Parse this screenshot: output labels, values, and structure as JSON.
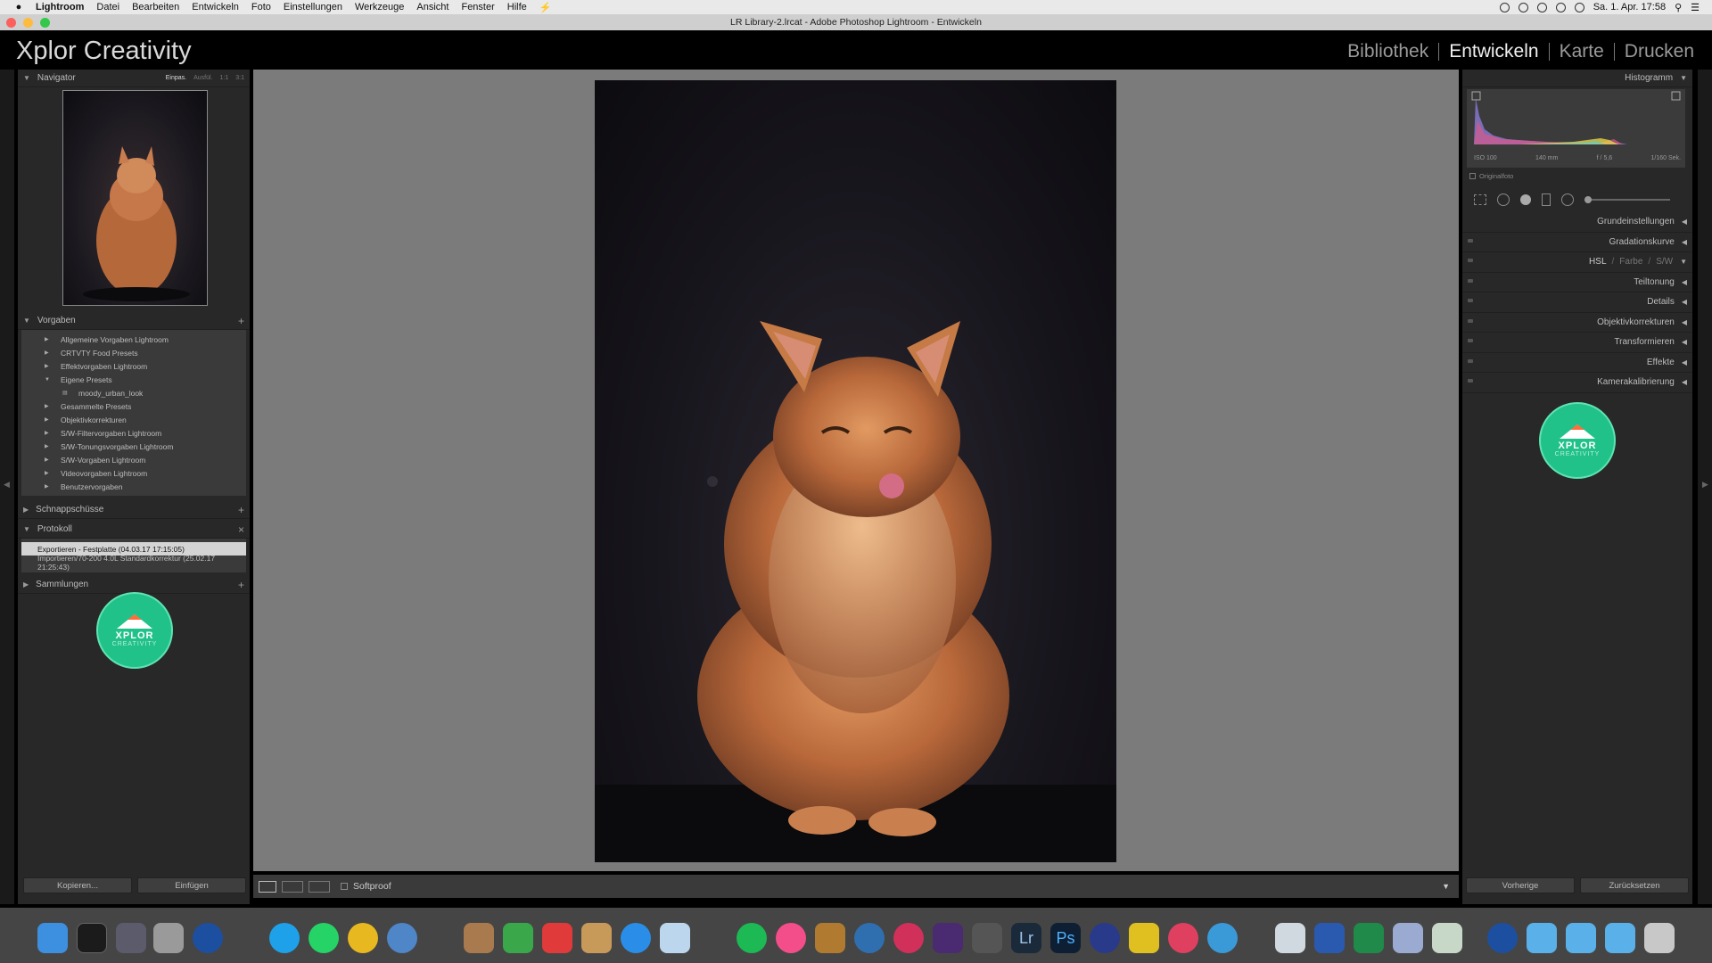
{
  "menubar": {
    "app": "Lightroom",
    "items": [
      "Datei",
      "Bearbeiten",
      "Entwickeln",
      "Foto",
      "Einstellungen",
      "Werkzeuge",
      "Ansicht",
      "Fenster",
      "Hilfe"
    ],
    "datetime": "Sa. 1. Apr. 17:58"
  },
  "window": {
    "title": "LR Library-2.lrcat - Adobe Photoshop Lightroom - Entwickeln"
  },
  "brand": "Xplor Creativity",
  "modules": [
    "Bibliothek",
    "Entwickeln",
    "Karte",
    "Drucken"
  ],
  "active_module": "Entwickeln",
  "navigator": {
    "title": "Navigator",
    "options": [
      "Einpas.",
      "Ausfül.",
      "1:1",
      "3:1"
    ]
  },
  "presets": {
    "title": "Vorgaben",
    "items": [
      {
        "label": "Allgemeine Vorgaben Lightroom"
      },
      {
        "label": "CRTVTY Food Presets"
      },
      {
        "label": "Effektvorgaben Lightroom"
      },
      {
        "label": "Eigene Presets"
      },
      {
        "label": "moody_urban_look"
      },
      {
        "label": "Gesammelte Presets"
      },
      {
        "label": "Objektivkorrekturen"
      },
      {
        "label": "S/W-Filtervorgaben Lightroom"
      },
      {
        "label": "S/W-Tonungsvorgaben Lightroom"
      },
      {
        "label": "S/W-Vorgaben Lightroom"
      },
      {
        "label": "Videovorgaben Lightroom"
      },
      {
        "label": "Benutzervorgaben"
      }
    ]
  },
  "snapshots": {
    "title": "Schnappschüsse"
  },
  "history": {
    "title": "Protokoll",
    "items": [
      "Exportieren - Festplatte (04.03.17 17:15:05)",
      "Importieren/70-200 4.0L Standardkorrektur (25.02.17 21:25:43)"
    ]
  },
  "collections": {
    "title": "Sammlungen"
  },
  "left_buttons": {
    "copy": "Kopieren...",
    "paste": "Einfügen"
  },
  "toolbar": {
    "softproof": "Softproof"
  },
  "histogram": {
    "title": "Histogramm",
    "info": [
      "ISO 100",
      "140 mm",
      "f / 5,6",
      "1/160 Sek."
    ],
    "original_photo": "Originalfoto"
  },
  "right_panels": [
    "Grundeinstellungen",
    "Gradationskurve",
    "HSL",
    "Teiltonung",
    "Details",
    "Objektivkorrekturen",
    "Transformieren",
    "Effekte",
    "Kamerakalibrierung"
  ],
  "hsl_tabs": [
    "Farbe",
    "S/W"
  ],
  "right_buttons": {
    "previous": "Vorherige",
    "reset": "Zurücksetzen"
  },
  "logo": {
    "line1": "XPLOR",
    "line2": "CREATIVITY"
  },
  "colors": {
    "logo_green": "#21c28a",
    "panel": "#282828",
    "canvas": "#7b7b7b"
  }
}
